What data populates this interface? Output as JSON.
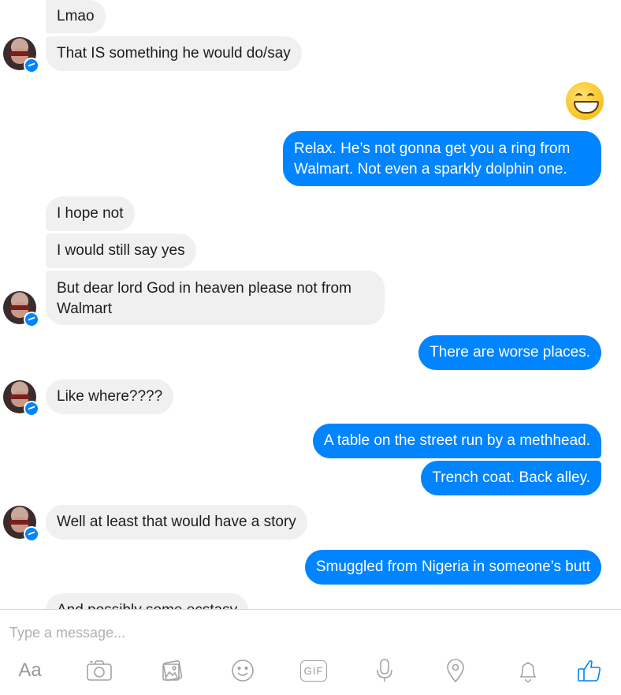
{
  "colors": {
    "incoming_bubble": "#f1f0f0",
    "outgoing_bubble": "#0084ff",
    "accent": "#0084ff"
  },
  "messages": [
    {
      "text": "Lmao",
      "sender": "them"
    },
    {
      "text": "That IS something he would do/say",
      "sender": "them"
    },
    {
      "text": "😁",
      "sender": "me",
      "kind": "emoji",
      "icon": "grinning-emoji-icon"
    },
    {
      "text": "Relax. He’s not gonna get you a ring from Walmart. Not even a sparkly dolphin one.",
      "sender": "me"
    },
    {
      "text": "I hope not",
      "sender": "them"
    },
    {
      "text": "I would still say yes",
      "sender": "them"
    },
    {
      "text": "But dear lord God in heaven please not from Walmart",
      "sender": "them"
    },
    {
      "text": "There are worse places.",
      "sender": "me"
    },
    {
      "text": "Like where????",
      "sender": "them"
    },
    {
      "text": "A table on the street run by a methhead.",
      "sender": "me"
    },
    {
      "text": "Trench coat. Back alley.",
      "sender": "me"
    },
    {
      "text": "Well at least that would have a story",
      "sender": "them"
    },
    {
      "text": "Smuggled from Nigeria in someone’s butt",
      "sender": "me"
    },
    {
      "text": "And possibly some ecstasy",
      "sender": "them"
    }
  ],
  "composer": {
    "placeholder": "Type a message...",
    "aa_label": "Aa",
    "gif_label": "GIF",
    "tools": [
      "aa-icon",
      "camera-icon",
      "photo-gallery-icon",
      "smiley-icon",
      "gif-icon",
      "microphone-icon",
      "location-pin-icon",
      "bell-icon",
      "thumbs-up-icon"
    ]
  }
}
